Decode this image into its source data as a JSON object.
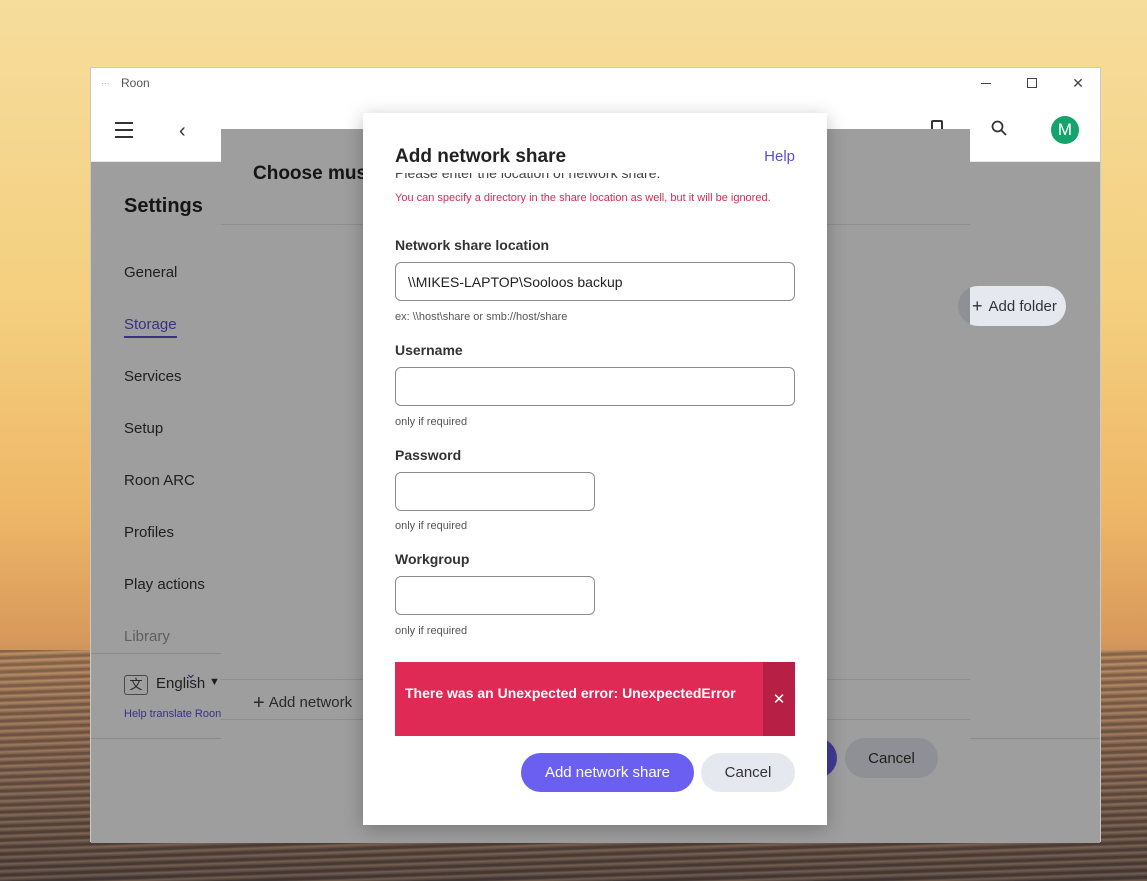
{
  "window": {
    "title": "Roon",
    "min_icon": "minimize-icon",
    "max_icon": "maximize-icon",
    "close_glyph": "✕"
  },
  "app": {
    "avatar_letter": "M",
    "settings_title": "Settings",
    "nav": [
      {
        "label": "General",
        "active": false
      },
      {
        "label": "Storage",
        "active": true
      },
      {
        "label": "Services",
        "active": false
      },
      {
        "label": "Setup",
        "active": false
      },
      {
        "label": "Roon ARC",
        "active": false
      },
      {
        "label": "Profiles",
        "active": false
      },
      {
        "label": "Play actions",
        "active": false
      },
      {
        "label": "Library",
        "active": false
      }
    ],
    "language": "English",
    "help_translate": "Help translate Roon"
  },
  "bg_dialog": {
    "title": "Choose music",
    "add_folder": "Add folder",
    "add_network": "Add network",
    "cancel": "Cancel"
  },
  "modal": {
    "title": "Add network share",
    "help": "Help",
    "intro": "Please enter the location of network share.",
    "warning": "You can specify a directory in the share location as well, but it will be ignored.",
    "location": {
      "label": "Network share location",
      "value": "\\\\MIKES-LAPTOP\\Sooloos backup",
      "hint": "ex: \\\\host\\share or smb://host/share"
    },
    "username": {
      "label": "Username",
      "value": "",
      "hint": "only if required"
    },
    "password": {
      "label": "Password",
      "value": "",
      "hint": "only if required"
    },
    "workgroup": {
      "label": "Workgroup",
      "value": "",
      "hint": "only if required"
    },
    "error": "There was an Unexpected error: UnexpectedError",
    "error_close": "✕",
    "submit": "Add network share",
    "cancel": "Cancel"
  },
  "colors": {
    "accent": "#6a5ff0",
    "error": "#df2a55",
    "link": "#5b4fd6",
    "avatar": "#14a36c"
  }
}
